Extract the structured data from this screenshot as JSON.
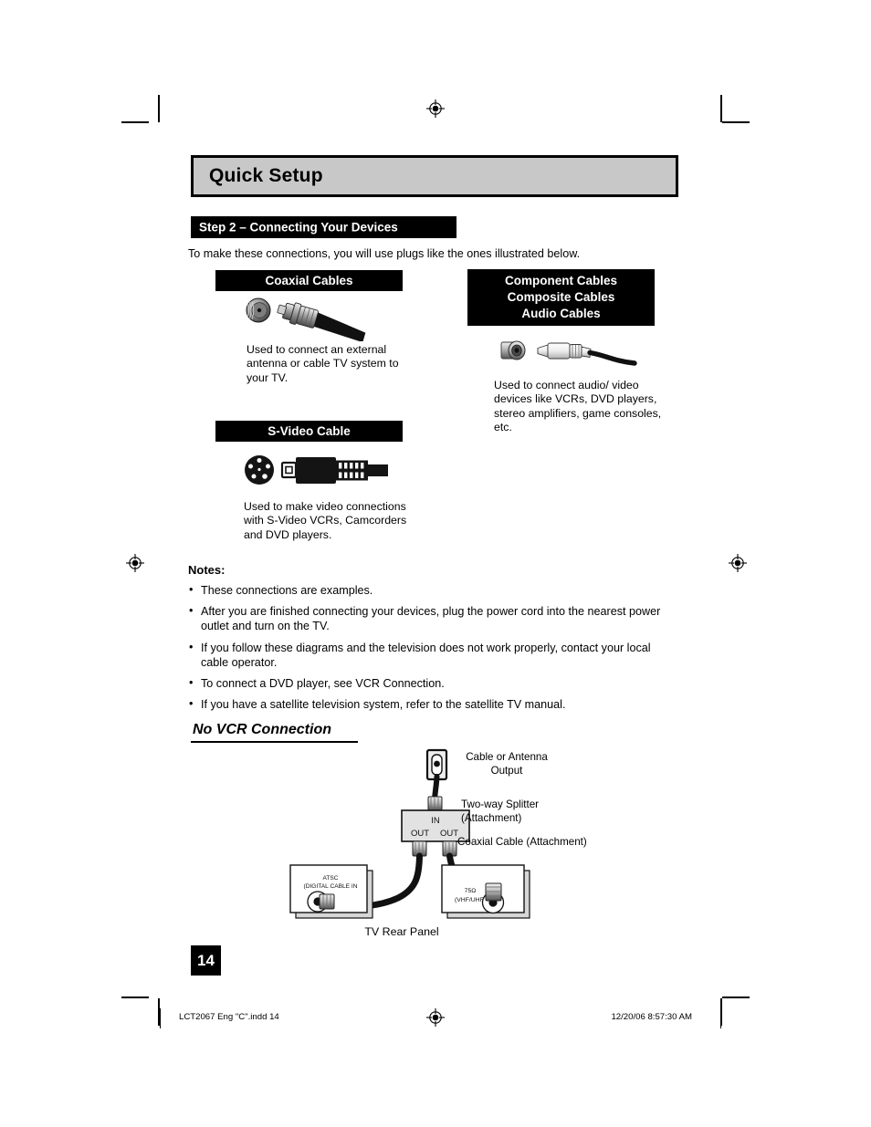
{
  "header": {
    "title": "Quick Setup",
    "step_bar": "Step 2 – Connecting Your Devices",
    "intro": "To make these connections, you will use plugs like the ones illustrated below."
  },
  "cables": {
    "coaxial": {
      "caption": "Coaxial Cables",
      "description": "Used to connect  an external antenna or cable TV system to your TV.",
      "jack_icon": "coax-jack-icon",
      "plug_icon": "f-connector-plug-icon"
    },
    "svideo": {
      "caption": "S-Video Cable",
      "description": "Used to make video connections with S-Video VCRs, Camcorders and DVD players.",
      "jack_icon": "svideo-4pin-din-jack-icon",
      "plug_icon": "svideo-plug-icon"
    },
    "rca": {
      "caption_line1": "Component Cables",
      "caption_line2": "Composite Cables",
      "caption_line3": "Audio Cables",
      "description": "Used to connect audio/ video devices like VCRs, DVD players, stereo amplifiers, game consoles, etc.",
      "jack_icon": "rca-jack-icon",
      "plug_icon": "rca-plug-icon"
    }
  },
  "notes": {
    "title": "Notes:",
    "bullet": "•",
    "items": [
      "These connections are examples.",
      "After you are finished connecting your devices, plug the power cord into the nearest power outlet and turn on the TV.",
      "If you follow these diagrams and the television does not work properly, contact your local cable operator.",
      "To connect a DVD player, see VCR Connection.",
      "If you have a satellite television system, refer to the satellite TV manual."
    ]
  },
  "diagram": {
    "title": "No VCR Connection",
    "labels": {
      "cable_or_antenna": "Cable or Antenna\nOutput",
      "cable_or_antenna_line1": "Cable or Antenna",
      "cable_or_antenna_line2": "Output",
      "splitter_line1": "Two-way Splitter",
      "splitter_line2": "(Attachment)",
      "coaxial_cable": "Coaxial Cable (Attachment)",
      "tv_rear_panel": "TV Rear Panel"
    },
    "splitter": {
      "in": "IN",
      "out_left": "OUT",
      "out_right": "OUT"
    },
    "tv_jacks": {
      "atsc_line1": "ATSC",
      "atsc_line2": "(DIGITAL CABLE IN",
      "antenna_line1": "75Ω",
      "antenna_line2": "(VHF/UHF)"
    }
  },
  "page_number": "14",
  "footer": {
    "left": "LCT2067 Eng \"C\".indd   14",
    "right": "12/20/06   8:57:30 AM"
  },
  "colors": {
    "banner_gray": "#c8c8c8",
    "bar_black": "#000000",
    "paper": "#ffffff"
  }
}
